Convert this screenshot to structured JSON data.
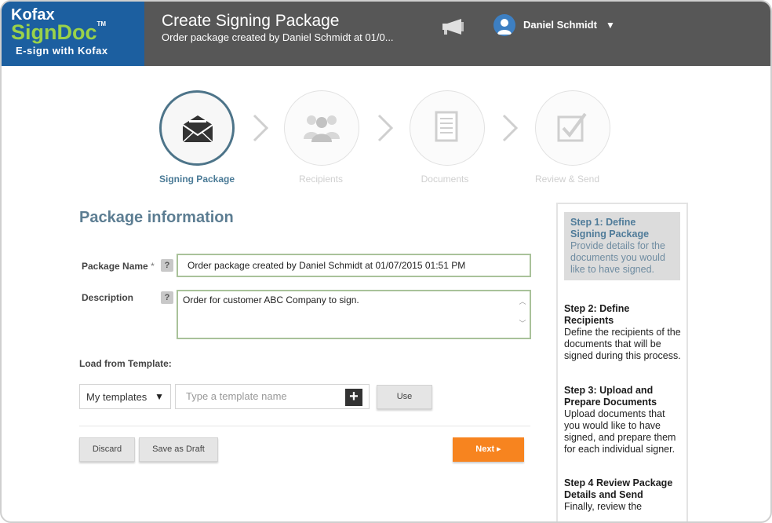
{
  "app": {
    "logo_line1": "Kofax",
    "logo_line2": "SignDoc",
    "logo_tm": "TM",
    "logo_line3": "E-sign with Kofax"
  },
  "header": {
    "title": "Create Signing Package",
    "subtitle": "Order package created by Daniel Schmidt at 01/0...",
    "user_name": "Daniel Schmidt",
    "user_caret": "▼"
  },
  "steps": [
    {
      "label": "Signing Package",
      "icon": "envelope-icon",
      "active": true
    },
    {
      "label": "Recipients",
      "icon": "people-icon",
      "active": false
    },
    {
      "label": "Documents",
      "icon": "document-icon",
      "active": false
    },
    {
      "label": "Review & Send",
      "icon": "checkbox-icon",
      "active": false
    }
  ],
  "form": {
    "section_title": "Package information",
    "package_name_label": "Package Name",
    "required_mark": "*",
    "help_glyph": "?",
    "package_name_value": "Order package created by Daniel Schmidt at 01/07/2015 01:51 PM",
    "description_label": "Description",
    "description_value": "Order for customer ABC Company to sign.",
    "load_template_label": "Load from Template:",
    "template_select_value": "My templates",
    "template_select_caret": "▼",
    "template_input_placeholder": "Type a template name",
    "plus_glyph": "+",
    "use_button": "Use",
    "discard_button": "Discard",
    "save_draft_button": "Save as Draft",
    "next_button": "Next ▸"
  },
  "side_panel": [
    {
      "heading": "Step 1: Define Signing Package",
      "body": "Provide details for the documents you would like to have signed."
    },
    {
      "heading": "Step 2: Define Recipients",
      "body": "Define the recipients of the documents that will be signed during this process."
    },
    {
      "heading": "Step 3: Upload and Prepare Documents",
      "body": "Upload documents that you would like to have signed, and prepare them for each individual signer."
    },
    {
      "heading": "Step 4 Review Package Details and Send",
      "body": "Finally, review the"
    }
  ],
  "colors": {
    "header_bg": "#575757",
    "logo_bg": "#1c5fa0",
    "accent_green": "#9ad24a",
    "active_step": "#4a7a96",
    "next_button": "#f7841f"
  }
}
